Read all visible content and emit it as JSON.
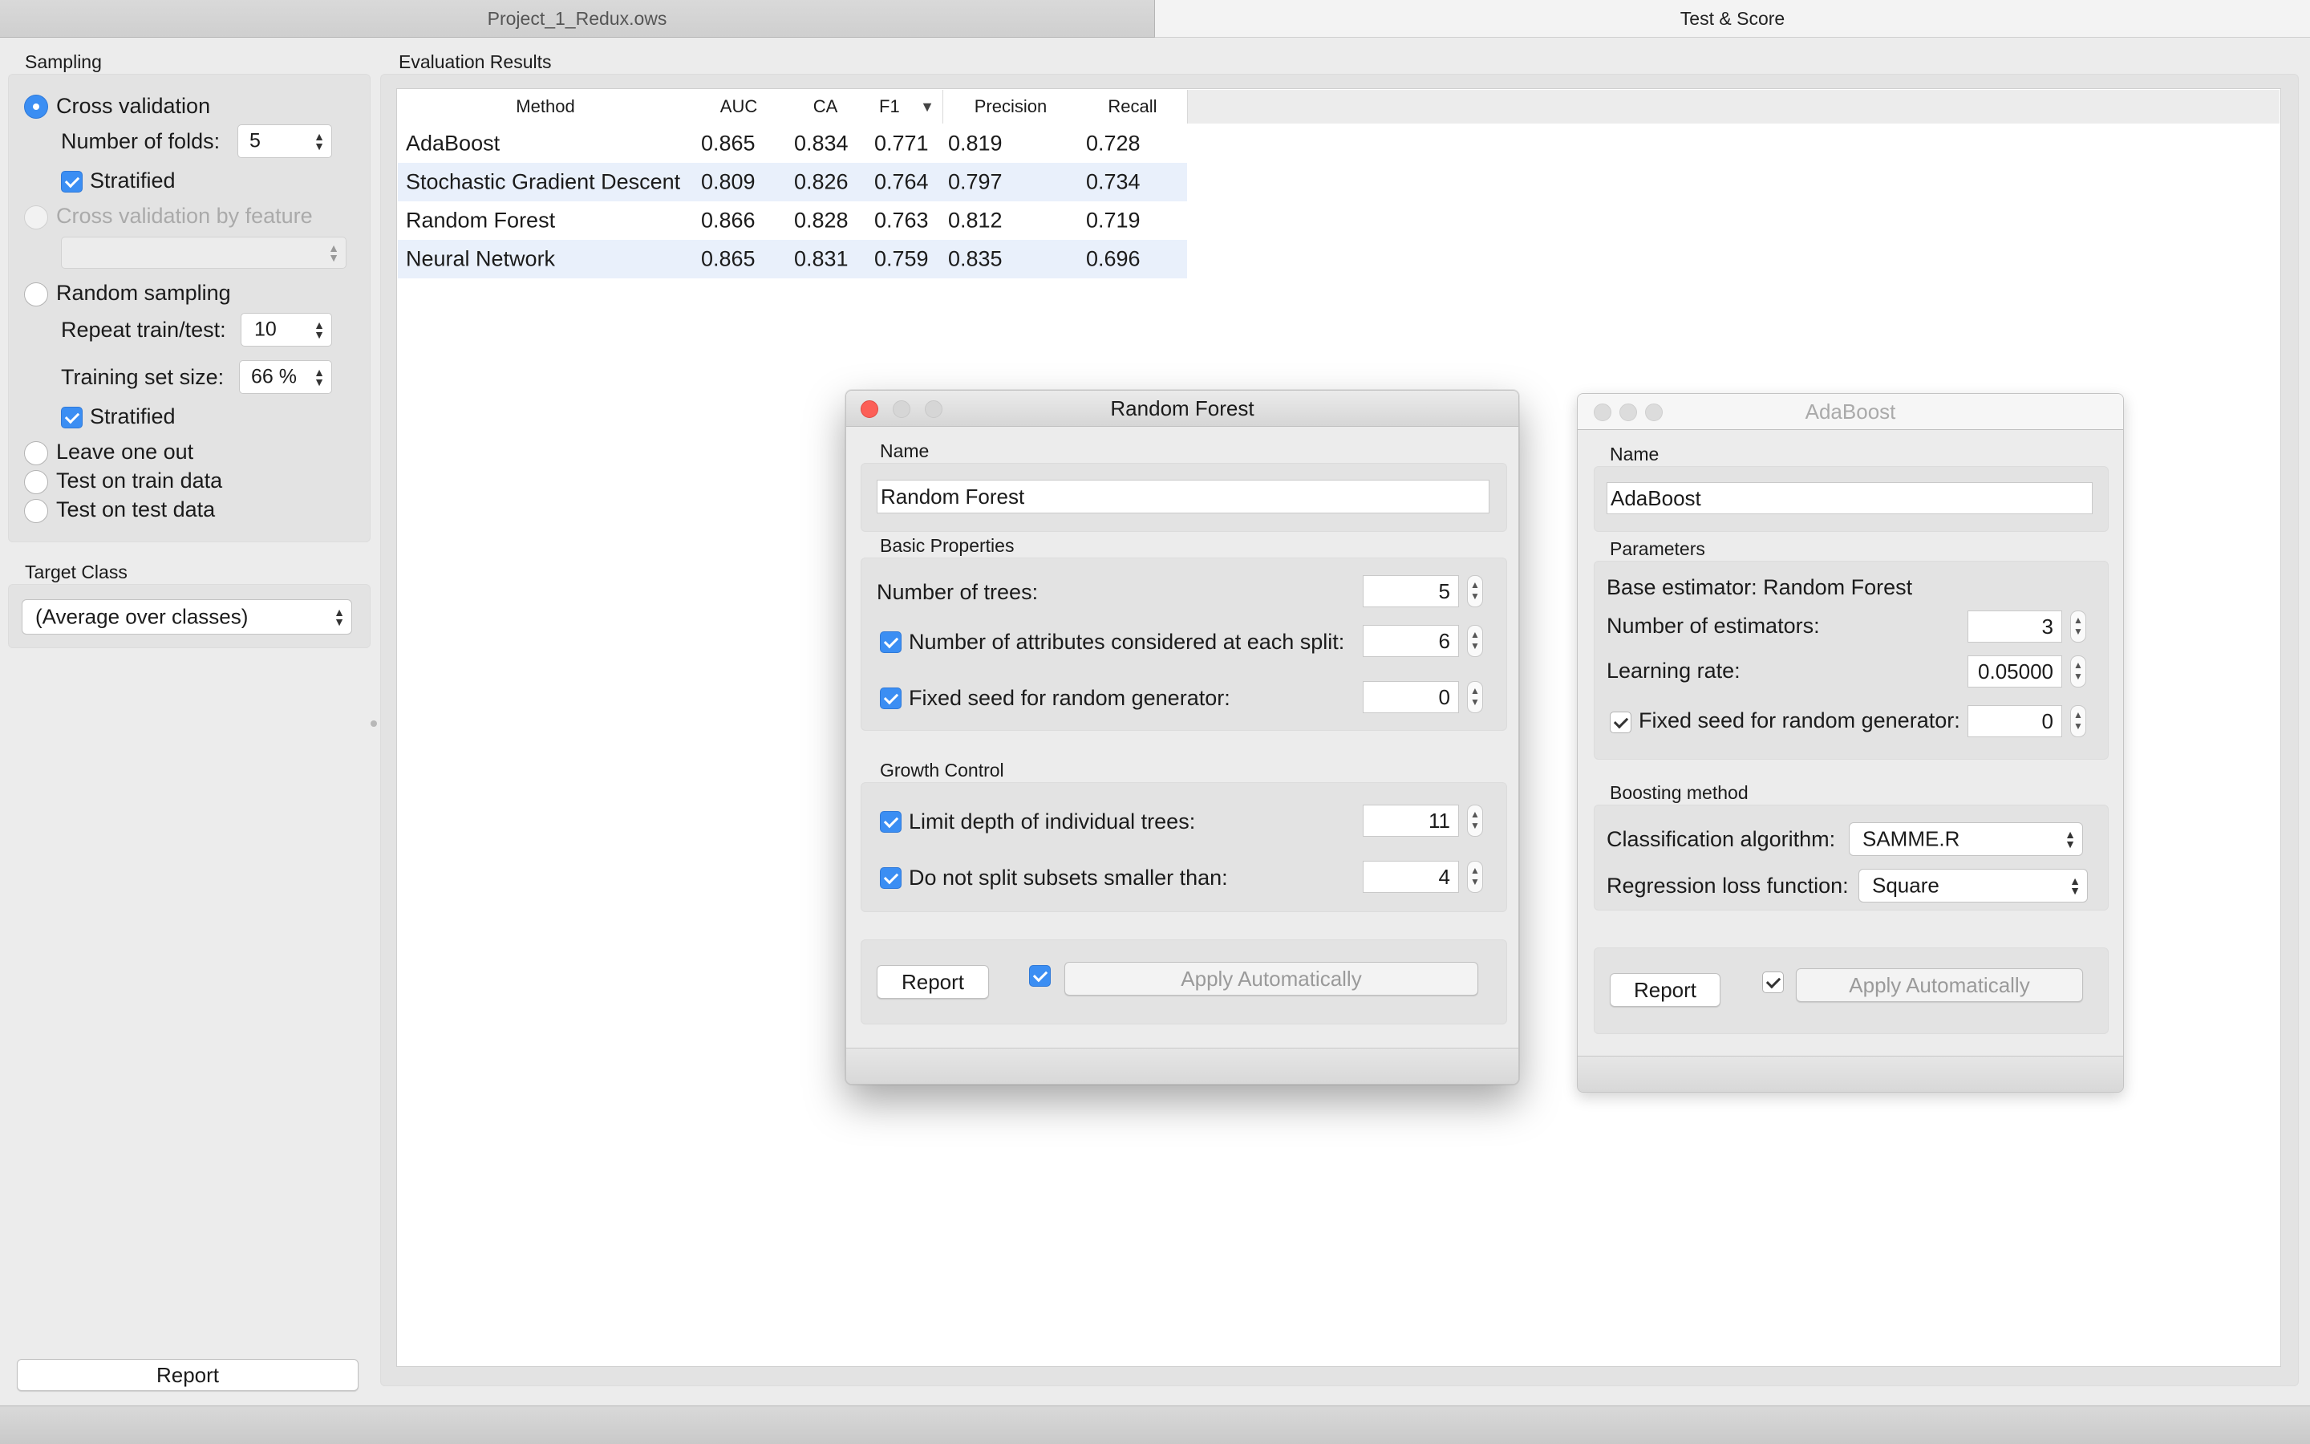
{
  "tabs": [
    "Project_1_Redux.ows",
    "Test & Score"
  ],
  "sampling": {
    "title": "Sampling",
    "cross_validation": "Cross validation",
    "folds_label": "Number of folds:",
    "folds_value": "5",
    "stratified": "Stratified",
    "cv_by_feature": "Cross validation by feature",
    "random_sampling": "Random sampling",
    "repeat_label": "Repeat train/test:",
    "repeat_value": "10",
    "train_size_label": "Training set size:",
    "train_size_value": "66 %",
    "stratified2": "Stratified",
    "leave_one_out": "Leave one out",
    "test_train": "Test on train data",
    "test_test": "Test on test data"
  },
  "target": {
    "title": "Target Class",
    "value": "(Average over classes)"
  },
  "report_label": "Report",
  "results": {
    "title": "Evaluation Results",
    "headers": [
      "Method",
      "AUC",
      "CA",
      "F1",
      "Precision",
      "Recall"
    ],
    "sort_indicator": "▼",
    "rows": [
      [
        "AdaBoost",
        "0.865",
        "0.834",
        "0.771",
        "0.819",
        "0.728"
      ],
      [
        "Stochastic Gradient Descent",
        "0.809",
        "0.826",
        "0.764",
        "0.797",
        "0.734"
      ],
      [
        "Random Forest",
        "0.866",
        "0.828",
        "0.763",
        "0.812",
        "0.719"
      ],
      [
        "Neural Network",
        "0.865",
        "0.831",
        "0.759",
        "0.835",
        "0.696"
      ]
    ]
  },
  "rf_dialog": {
    "title": "Random Forest",
    "name_label": "Name",
    "name_value": "Random Forest",
    "basic_title": "Basic Properties",
    "trees_label": "Number of trees:",
    "trees_value": "5",
    "attrs_label": "Number of attributes considered at each split:",
    "attrs_value": "6",
    "seed_label": "Fixed seed for random generator:",
    "seed_value": "0",
    "growth_title": "Growth Control",
    "depth_label": "Limit depth of individual trees:",
    "depth_value": "11",
    "split_label": "Do not split subsets smaller than:",
    "split_value": "4",
    "report": "Report",
    "apply": "Apply Automatically"
  },
  "ada_dialog": {
    "title": "AdaBoost",
    "name_label": "Name",
    "name_value": "AdaBoost",
    "params_title": "Parameters",
    "base_estimator": "Base estimator: Random Forest",
    "estimators_label": "Number of estimators:",
    "estimators_value": "3",
    "lr_label": "Learning rate:",
    "lr_value": "0.05000",
    "seed_label": "Fixed seed for random generator:",
    "seed_value": "0",
    "boosting_title": "Boosting method",
    "class_algo_label": "Classification algorithm:",
    "class_algo_value": "SAMME.R",
    "reg_loss_label": "Regression loss function:",
    "reg_loss_value": "Square",
    "report": "Report",
    "apply": "Apply Automatically"
  }
}
